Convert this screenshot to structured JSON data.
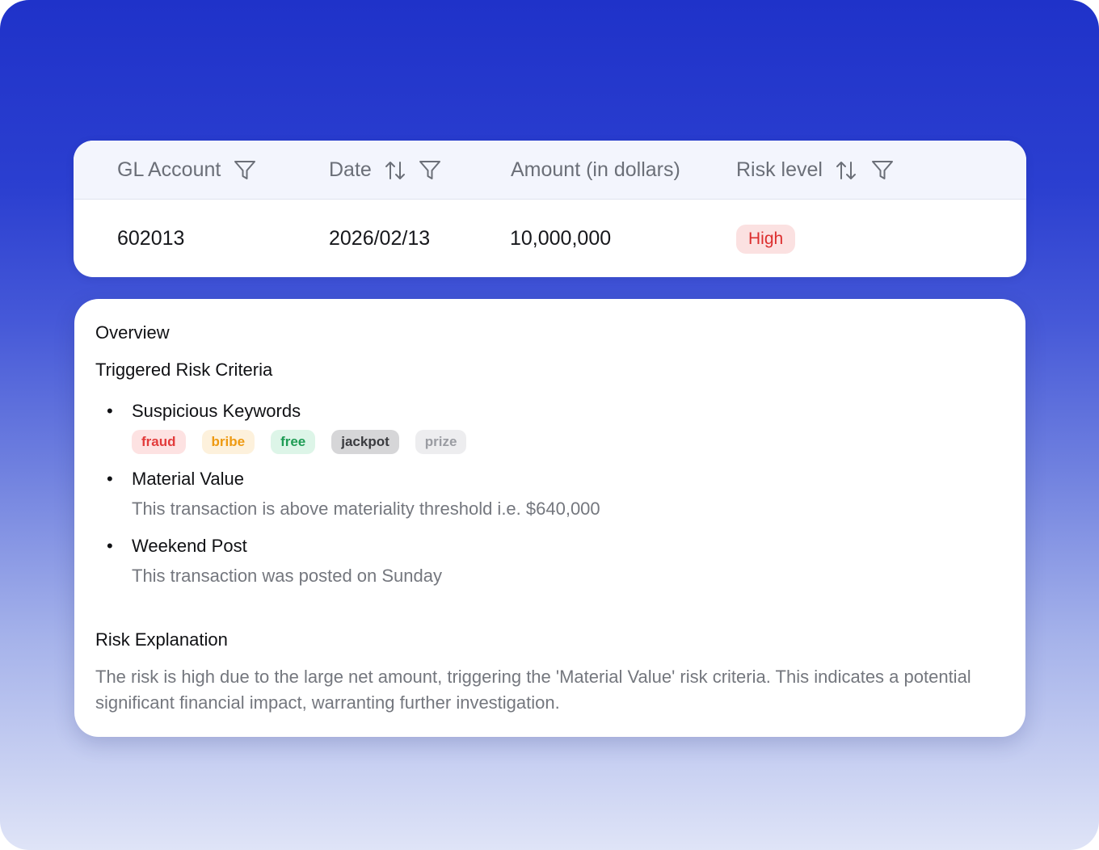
{
  "table": {
    "columns": [
      {
        "label": "GL Account",
        "filterable": true,
        "sortable": false,
        "filter_icon": "filter-icon"
      },
      {
        "label": "Date",
        "filterable": true,
        "sortable": true,
        "sort_icon": "sort-icon",
        "filter_icon": "filter-icon"
      },
      {
        "label": "Amount (in dollars)",
        "filterable": false,
        "sortable": false
      },
      {
        "label": "Risk level",
        "filterable": true,
        "sortable": true,
        "sort_icon": "sort-icon",
        "filter_icon": "filter-icon"
      }
    ],
    "row": {
      "gl_account": "602013",
      "date": "2026/02/13",
      "amount": "10,000,000",
      "risk_level": "High"
    }
  },
  "detail": {
    "overview_title": "Overview",
    "triggered_title": "Triggered Risk Criteria",
    "bullet": "•",
    "criteria": [
      {
        "title": "Suspicious Keywords",
        "keywords": [
          "fraud",
          "bribe",
          "free",
          "jackpot",
          "prize"
        ]
      },
      {
        "title": "Material Value",
        "description": "This transaction is above materiality threshold i.e. $640,000"
      },
      {
        "title": "Weekend Post",
        "description": "This transaction was posted on Sunday"
      }
    ],
    "risk_explanation_title": "Risk Explanation",
    "risk_explanation": "The risk is high due to the large net amount, triggering the 'Material Value' risk criteria. This indicates a potential significant financial impact, warranting further investigation."
  },
  "colors": {
    "risk_high_bg": "#fbe1e1",
    "risk_high_text": "#dc2e2e",
    "tag_fraud": "#e23b3b",
    "tag_bribe": "#ee9a12",
    "tag_free": "#1f9c55",
    "tag_jackpot": "#3a3b3f",
    "tag_prize": "#9a9ca2",
    "background_top": "#1f32c9"
  }
}
